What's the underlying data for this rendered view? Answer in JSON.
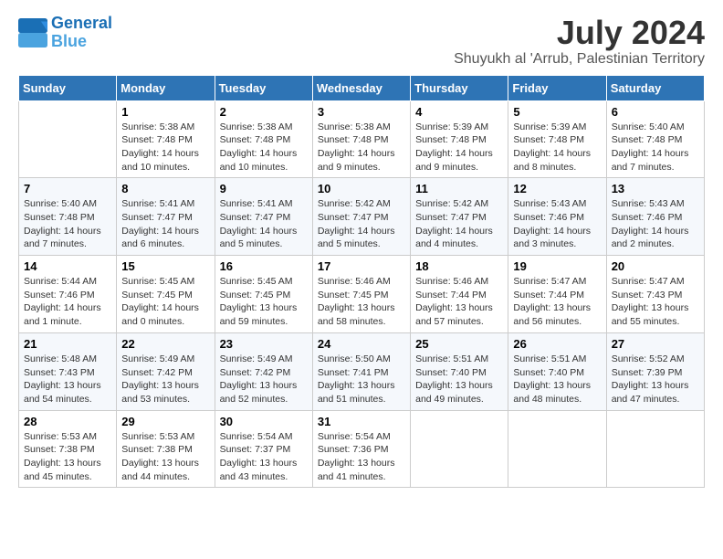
{
  "logo": {
    "line1": "General",
    "line2": "Blue"
  },
  "title": "July 2024",
  "subtitle": "Shuyukh al 'Arrub, Palestinian Territory",
  "days_of_week": [
    "Sunday",
    "Monday",
    "Tuesday",
    "Wednesday",
    "Thursday",
    "Friday",
    "Saturday"
  ],
  "weeks": [
    [
      {
        "day": "",
        "info": ""
      },
      {
        "day": "1",
        "info": "Sunrise: 5:38 AM\nSunset: 7:48 PM\nDaylight: 14 hours\nand 10 minutes."
      },
      {
        "day": "2",
        "info": "Sunrise: 5:38 AM\nSunset: 7:48 PM\nDaylight: 14 hours\nand 10 minutes."
      },
      {
        "day": "3",
        "info": "Sunrise: 5:38 AM\nSunset: 7:48 PM\nDaylight: 14 hours\nand 9 minutes."
      },
      {
        "day": "4",
        "info": "Sunrise: 5:39 AM\nSunset: 7:48 PM\nDaylight: 14 hours\nand 9 minutes."
      },
      {
        "day": "5",
        "info": "Sunrise: 5:39 AM\nSunset: 7:48 PM\nDaylight: 14 hours\nand 8 minutes."
      },
      {
        "day": "6",
        "info": "Sunrise: 5:40 AM\nSunset: 7:48 PM\nDaylight: 14 hours\nand 7 minutes."
      }
    ],
    [
      {
        "day": "7",
        "info": "Sunrise: 5:40 AM\nSunset: 7:48 PM\nDaylight: 14 hours\nand 7 minutes."
      },
      {
        "day": "8",
        "info": "Sunrise: 5:41 AM\nSunset: 7:47 PM\nDaylight: 14 hours\nand 6 minutes."
      },
      {
        "day": "9",
        "info": "Sunrise: 5:41 AM\nSunset: 7:47 PM\nDaylight: 14 hours\nand 5 minutes."
      },
      {
        "day": "10",
        "info": "Sunrise: 5:42 AM\nSunset: 7:47 PM\nDaylight: 14 hours\nand 5 minutes."
      },
      {
        "day": "11",
        "info": "Sunrise: 5:42 AM\nSunset: 7:47 PM\nDaylight: 14 hours\nand 4 minutes."
      },
      {
        "day": "12",
        "info": "Sunrise: 5:43 AM\nSunset: 7:46 PM\nDaylight: 14 hours\nand 3 minutes."
      },
      {
        "day": "13",
        "info": "Sunrise: 5:43 AM\nSunset: 7:46 PM\nDaylight: 14 hours\nand 2 minutes."
      }
    ],
    [
      {
        "day": "14",
        "info": "Sunrise: 5:44 AM\nSunset: 7:46 PM\nDaylight: 14 hours\nand 1 minute."
      },
      {
        "day": "15",
        "info": "Sunrise: 5:45 AM\nSunset: 7:45 PM\nDaylight: 14 hours\nand 0 minutes."
      },
      {
        "day": "16",
        "info": "Sunrise: 5:45 AM\nSunset: 7:45 PM\nDaylight: 13 hours\nand 59 minutes."
      },
      {
        "day": "17",
        "info": "Sunrise: 5:46 AM\nSunset: 7:45 PM\nDaylight: 13 hours\nand 58 minutes."
      },
      {
        "day": "18",
        "info": "Sunrise: 5:46 AM\nSunset: 7:44 PM\nDaylight: 13 hours\nand 57 minutes."
      },
      {
        "day": "19",
        "info": "Sunrise: 5:47 AM\nSunset: 7:44 PM\nDaylight: 13 hours\nand 56 minutes."
      },
      {
        "day": "20",
        "info": "Sunrise: 5:47 AM\nSunset: 7:43 PM\nDaylight: 13 hours\nand 55 minutes."
      }
    ],
    [
      {
        "day": "21",
        "info": "Sunrise: 5:48 AM\nSunset: 7:43 PM\nDaylight: 13 hours\nand 54 minutes."
      },
      {
        "day": "22",
        "info": "Sunrise: 5:49 AM\nSunset: 7:42 PM\nDaylight: 13 hours\nand 53 minutes."
      },
      {
        "day": "23",
        "info": "Sunrise: 5:49 AM\nSunset: 7:42 PM\nDaylight: 13 hours\nand 52 minutes."
      },
      {
        "day": "24",
        "info": "Sunrise: 5:50 AM\nSunset: 7:41 PM\nDaylight: 13 hours\nand 51 minutes."
      },
      {
        "day": "25",
        "info": "Sunrise: 5:51 AM\nSunset: 7:40 PM\nDaylight: 13 hours\nand 49 minutes."
      },
      {
        "day": "26",
        "info": "Sunrise: 5:51 AM\nSunset: 7:40 PM\nDaylight: 13 hours\nand 48 minutes."
      },
      {
        "day": "27",
        "info": "Sunrise: 5:52 AM\nSunset: 7:39 PM\nDaylight: 13 hours\nand 47 minutes."
      }
    ],
    [
      {
        "day": "28",
        "info": "Sunrise: 5:53 AM\nSunset: 7:38 PM\nDaylight: 13 hours\nand 45 minutes."
      },
      {
        "day": "29",
        "info": "Sunrise: 5:53 AM\nSunset: 7:38 PM\nDaylight: 13 hours\nand 44 minutes."
      },
      {
        "day": "30",
        "info": "Sunrise: 5:54 AM\nSunset: 7:37 PM\nDaylight: 13 hours\nand 43 minutes."
      },
      {
        "day": "31",
        "info": "Sunrise: 5:54 AM\nSunset: 7:36 PM\nDaylight: 13 hours\nand 41 minutes."
      },
      {
        "day": "",
        "info": ""
      },
      {
        "day": "",
        "info": ""
      },
      {
        "day": "",
        "info": ""
      }
    ]
  ]
}
